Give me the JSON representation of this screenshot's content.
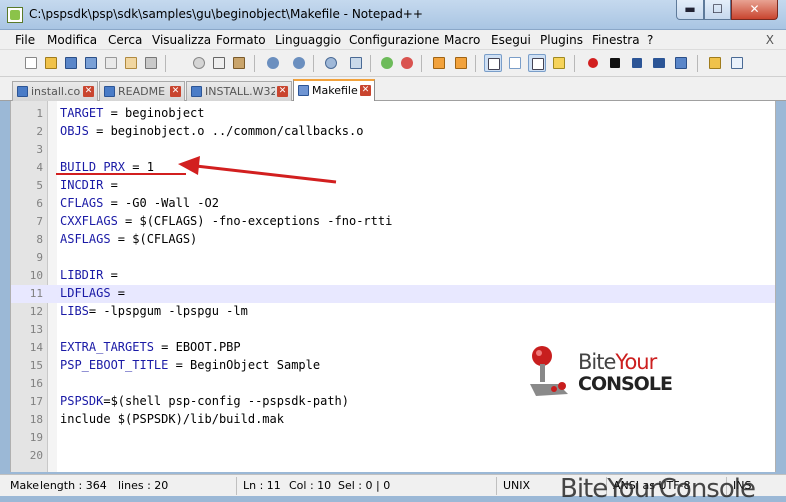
{
  "window": {
    "title": "C:\\pspsdk\\psp\\sdk\\samples\\gu\\beginobject\\Makefile - Notepad++",
    "min_glyph": "▬",
    "max_glyph": "☐",
    "close_glyph": "✕"
  },
  "menu": {
    "items": [
      "File",
      "Modifica",
      "Cerca",
      "Visualizza",
      "Formato",
      "Linguaggio",
      "Configurazione",
      "Macro",
      "Esegui",
      "Plugins",
      "Finestra",
      "?"
    ],
    "close_glyph": "X"
  },
  "toolbar": {
    "icons": [
      "new-file-icon",
      "open-file-icon",
      "save-icon",
      "save-all-icon",
      "close-icon",
      "close-all-icon",
      "print-icon",
      "cut-icon",
      "copy-icon",
      "paste-icon",
      "undo-icon",
      "redo-icon",
      "find-icon",
      "replace-icon",
      "zoom-in-icon",
      "zoom-out-icon",
      "sync-v-icon",
      "sync-h-icon",
      "wrap-icon",
      "all-chars-icon",
      "indent-guide-icon",
      "udl-icon",
      "record-macro-icon",
      "stop-macro-icon",
      "play-macro-icon",
      "run-macro-multiple-icon",
      "save-macro-icon",
      "folder-icon",
      "spellcheck-icon"
    ]
  },
  "tabs": [
    {
      "label": "install.com",
      "active": false
    },
    {
      "label": "README",
      "active": false
    },
    {
      "label": "INSTALL.W32",
      "active": false
    },
    {
      "label": "Makefile",
      "active": true
    }
  ],
  "editor": {
    "lines": [
      {
        "n": "1",
        "var": "TARGET",
        "rest": " = beginobject"
      },
      {
        "n": "2",
        "var": "OBJS",
        "rest": " = beginobject.o ../common/callbacks.o"
      },
      {
        "n": "3",
        "var": "",
        "rest": ""
      },
      {
        "n": "4",
        "var": "BUILD_PRX",
        "rest": " = 1"
      },
      {
        "n": "5",
        "var": "INCDIR",
        "rest": " ="
      },
      {
        "n": "6",
        "var": "CFLAGS",
        "rest": " = -G0 -Wall -O2"
      },
      {
        "n": "7",
        "var": "CXXFLAGS",
        "rest": " = $(CFLAGS) -fno-exceptions -fno-rtti"
      },
      {
        "n": "8",
        "var": "ASFLAGS",
        "rest": " = $(CFLAGS)"
      },
      {
        "n": "9",
        "var": "",
        "rest": ""
      },
      {
        "n": "10",
        "var": "LIBDIR",
        "rest": " ="
      },
      {
        "n": "11",
        "var": "LDFLAGS",
        "rest": " ="
      },
      {
        "n": "12",
        "var": "LIBS",
        "rest": "= -lpspgum -lpspgu -lm"
      },
      {
        "n": "13",
        "var": "",
        "rest": ""
      },
      {
        "n": "14",
        "var": "EXTRA_TARGETS",
        "rest": " = EBOOT.PBP"
      },
      {
        "n": "15",
        "var": "PSP_EBOOT_TITLE",
        "rest": " = BeginObject Sample"
      },
      {
        "n": "16",
        "var": "",
        "rest": ""
      },
      {
        "n": "17",
        "var": "PSPSDK",
        "rest": "=$(shell psp-config --pspsdk-path)"
      },
      {
        "n": "18",
        "var": "",
        "rest": "include $(PSPSDK)/lib/build.mak"
      },
      {
        "n": "19",
        "var": "",
        "rest": ""
      },
      {
        "n": "20",
        "var": "",
        "rest": ""
      }
    ],
    "current_line": "11"
  },
  "logo": {
    "line1a": "Bite",
    "line1b": "Your",
    "line2": "CONSOLE"
  },
  "status": {
    "type": "Make",
    "length": "length : 364",
    "lines": "lines : 20",
    "ln": "Ln : 11",
    "col": "Col : 10",
    "sel": "Sel : 0 | 0",
    "eol": "UNIX",
    "encoding": "ANSI as UTF-8",
    "mode": "INS"
  },
  "footer_watermark": "BiteYourConsole",
  "colors": {
    "accent_red": "#d21f1f",
    "keyword_blue": "#1a1aa6",
    "current_line": "#e8e8ff",
    "active_tab_top": "#f2a23c"
  }
}
